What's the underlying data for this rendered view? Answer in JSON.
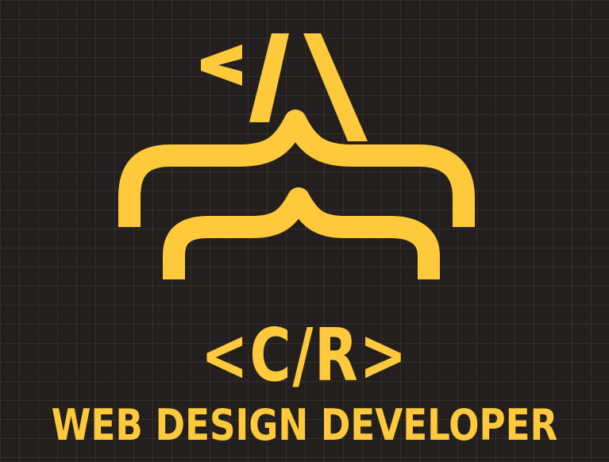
{
  "logo": {
    "monogram": "<C/R>",
    "tagline": "WEB DESIGN DEVELOPER",
    "emblem": "code-brace-peak-icon"
  },
  "colors": {
    "background": "#231f1e",
    "accent": "#ffc93c",
    "grid": "#3a3534"
  }
}
